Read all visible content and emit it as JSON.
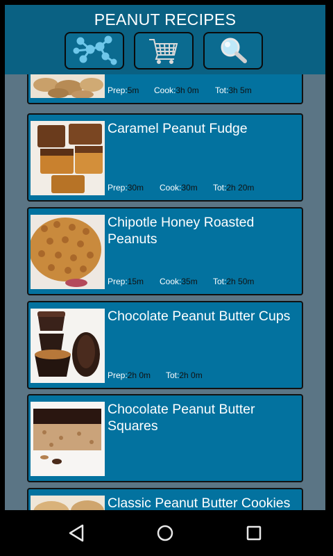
{
  "app": {
    "title": "PEANUT RECIPES"
  },
  "toolbar": {
    "buttons": [
      {
        "name": "categories-button",
        "icon": "molecule-icon"
      },
      {
        "name": "shopping-cart-button",
        "icon": "cart-icon"
      },
      {
        "name": "search-button",
        "icon": "magnifier-icon"
      }
    ]
  },
  "labels": {
    "prep": "Prep:",
    "cook": "Cook:",
    "tot": "Tot:"
  },
  "recipes": [
    {
      "title": "",
      "prep": "5m",
      "cook": "3h 0m",
      "tot": "3h 5m"
    },
    {
      "title": "Caramel Peanut Fudge",
      "prep": "30m",
      "cook": "30m",
      "tot": "2h 20m"
    },
    {
      "title": "Chipotle Honey Roasted Peanuts",
      "prep": "15m",
      "cook": "35m",
      "tot": "2h 50m"
    },
    {
      "title": "Chocolate Peanut Butter Cups",
      "prep": "2h 0m",
      "tot": "2h 0m"
    },
    {
      "title": "Chocolate Peanut Butter Squares"
    },
    {
      "title": "Classic Peanut Butter Cookies"
    }
  ],
  "navbar": {
    "buttons": [
      "back-icon",
      "home-icon",
      "recents-icon"
    ]
  },
  "colors": {
    "topbar": "#0a6183",
    "card": "#03729f",
    "background": "#5b7585"
  }
}
